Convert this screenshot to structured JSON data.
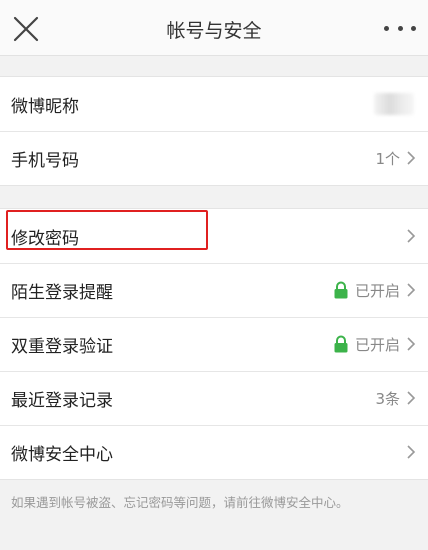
{
  "nav": {
    "title": "帐号与安全"
  },
  "group1": [
    {
      "label": "微博昵称",
      "value": ""
    },
    {
      "label": "手机号码",
      "value": "1个"
    }
  ],
  "group2": [
    {
      "label": "修改密码",
      "value": ""
    },
    {
      "label": "陌生登录提醒",
      "value": "已开启"
    },
    {
      "label": "双重登录验证",
      "value": "已开启"
    },
    {
      "label": "最近登录记录",
      "value": "3条"
    },
    {
      "label": "微博安全中心",
      "value": ""
    }
  ],
  "footer": {
    "note": "如果遇到帐号被盗、忘记密码等问题，请前往微博安全中心。"
  },
  "colors": {
    "lock": "#3cb34a",
    "highlight": "#e02020"
  }
}
